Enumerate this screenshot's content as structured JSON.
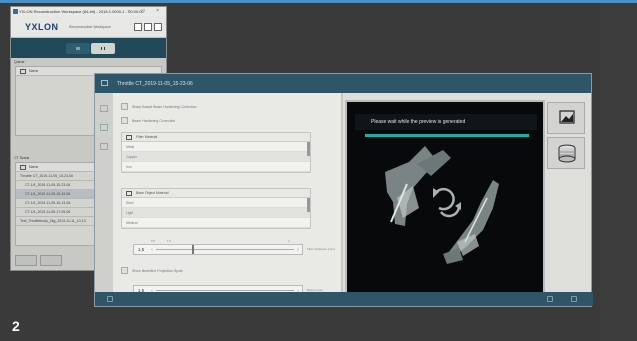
{
  "main_window": {
    "title": "YXLON Reconstruction Workspace (64-bit) - 2018.1.0000-1 - 00:00:00",
    "logo": "YXLON",
    "subtitle": "Reconstruction Workspace",
    "sections": {
      "queue": "Queue",
      "ct_scans": "CT Scans"
    },
    "queue_header": "Name",
    "scans_header": "Name",
    "scan_items": [
      "Throttle CT_2019-11-05_15-23-06",
      "CT-1/4_2019-11-05-15-23-06",
      "CT-1/4_2019-11-05-15-43-06",
      "CT-1/4_2019-11-05-16-13-06",
      "CT-1/4_2019-11-05-17-09-06",
      "Test_Throttlebody_2kg_2019-11-11_10-13"
    ]
  },
  "dialog": {
    "title": "Throttle CT_2019-11-05_15-23-06",
    "option_beam": "Sharp Based Beam Hardening Correction",
    "option_beam2": "Beam Hardening Correction",
    "filter_header": "Filter Material",
    "filter_rows": [
      "Metal",
      "Copper",
      "Iron"
    ],
    "object_header": "Base Object Material",
    "object_rows": [
      "Steel",
      "Light",
      "Medium"
    ],
    "slider1_value": "1,5",
    "slider1_note": "Filter thickness (mm)",
    "option_artifact": "Show Beamline Projection Spots",
    "slider2_value": "1,5",
    "slider2_note": "Beam cores",
    "tick_labels": [
      "0.5",
      "1.0",
      "4"
    ],
    "preview_message": "Please wait while the preview is generated",
    "preview_progress": 1.0
  },
  "panel_number": "2",
  "colors": {
    "accent": "#2f5568",
    "progress": "#1ab1a9",
    "band": "#22495a"
  }
}
